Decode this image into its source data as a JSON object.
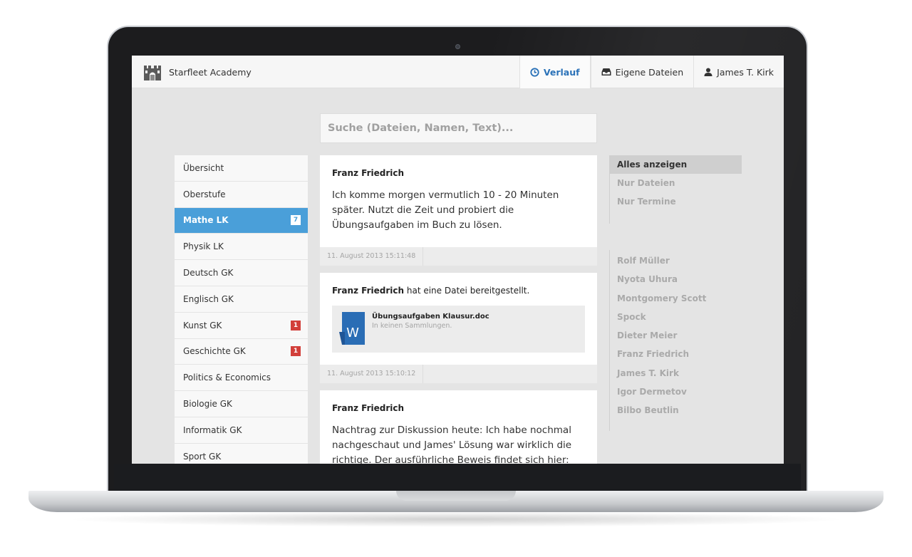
{
  "header": {
    "brand_name": "Starfleet Academy",
    "nav": [
      {
        "label": "Verlauf",
        "icon": "clock-icon",
        "active": true
      },
      {
        "label": "Eigene Dateien",
        "icon": "inbox-icon",
        "active": false
      },
      {
        "label": "James T. Kirk",
        "icon": "user-icon",
        "active": false
      }
    ]
  },
  "search": {
    "placeholder": "Suche (Dateien, Namen, Text)..."
  },
  "sidebar": {
    "items": [
      {
        "label": "Übersicht"
      },
      {
        "label": "Oberstufe"
      },
      {
        "label": "Mathe LK",
        "badge": "7",
        "active": true
      },
      {
        "label": "Physik LK"
      },
      {
        "label": "Deutsch GK"
      },
      {
        "label": "Englisch GK"
      },
      {
        "label": "Kunst GK",
        "badge": "1"
      },
      {
        "label": "Geschichte GK",
        "badge": "1"
      },
      {
        "label": "Politics & Economics"
      },
      {
        "label": "Biologie GK"
      },
      {
        "label": "Informatik GK"
      },
      {
        "label": "Sport GK"
      }
    ]
  },
  "feed": {
    "posts": [
      {
        "author": "Franz Friedrich",
        "text": "Ich komme morgen vermutlich 10 - 20 Minuten später. Nutzt die Zeit und probiert die Übungsaufgaben im Buch zu lösen.",
        "timestamp": "11. August 2013 15:11:48"
      },
      {
        "author": "Franz Friedrich",
        "action": "hat eine Datei bereitgestellt.",
        "file": {
          "name": "Übungsaufgaben Klausur.doc",
          "collections": "In keinen Sammlungen.",
          "icon_letter": "W"
        },
        "timestamp": "11. August 2013 15:10:12"
      },
      {
        "author": "Franz Friedrich",
        "text": "Nachtrag zur Diskussion heute: Ich habe nochmal nachgeschaut und James' Lösung war wirklich die richtige. Der ausführliche Beweis findet sich hier:"
      }
    ]
  },
  "filters": {
    "items": [
      {
        "label": "Alles anzeigen",
        "active": true
      },
      {
        "label": "Nur Dateien"
      },
      {
        "label": "Nur Termine"
      }
    ]
  },
  "people": {
    "items": [
      "Rolf Müller",
      "Nyota Uhura",
      "Montgomery Scott",
      "Spock",
      "Dieter Meier",
      "Franz Friedrich",
      "James T. Kirk",
      "Igor Dermetov",
      "Bilbo Beutlin"
    ]
  },
  "colors": {
    "accent": "#4a9fd9",
    "nav_active": "#2b72b8",
    "badge": "#d23f3a",
    "word_blue": "#2a6db5"
  }
}
